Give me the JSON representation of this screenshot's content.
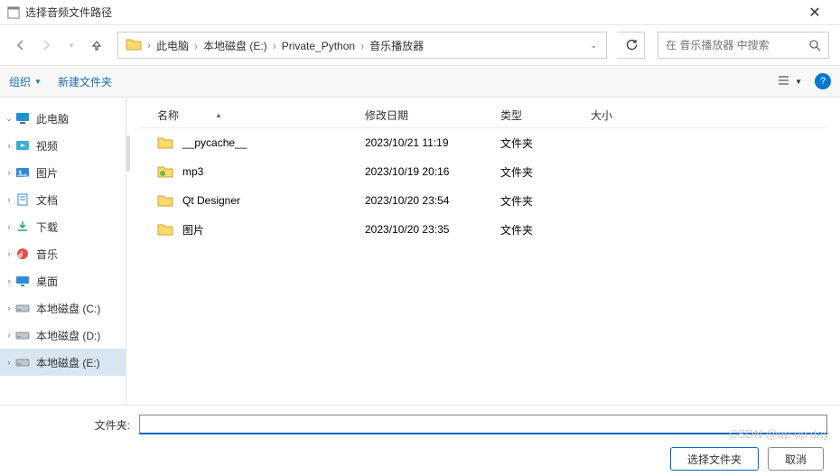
{
  "window": {
    "title": "选择音频文件路径"
  },
  "breadcrumbs": [
    "此电脑",
    "本地磁盘 (E:)",
    "Private_Python",
    "音乐播放器"
  ],
  "search": {
    "placeholder": "在 音乐播放器 中搜索"
  },
  "toolbar": {
    "organize": "组织",
    "newfolder": "新建文件夹"
  },
  "columns": {
    "name": "名称",
    "date": "修改日期",
    "type": "类型",
    "size": "大小"
  },
  "sidebar": [
    {
      "label": "此电脑",
      "icon": "pc",
      "expanded": true,
      "selected": false
    },
    {
      "label": "视频",
      "icon": "video",
      "expanded": false,
      "selected": false
    },
    {
      "label": "图片",
      "icon": "pictures",
      "expanded": false,
      "selected": false
    },
    {
      "label": "文档",
      "icon": "docs",
      "expanded": false,
      "selected": false
    },
    {
      "label": "下载",
      "icon": "downloads",
      "expanded": false,
      "selected": false
    },
    {
      "label": "音乐",
      "icon": "music",
      "expanded": false,
      "selected": false
    },
    {
      "label": "桌面",
      "icon": "desktop",
      "expanded": false,
      "selected": false
    },
    {
      "label": "本地磁盘 (C:)",
      "icon": "drive",
      "expanded": false,
      "selected": false
    },
    {
      "label": "本地磁盘 (D:)",
      "icon": "drive",
      "expanded": false,
      "selected": false
    },
    {
      "label": "本地磁盘 (E:)",
      "icon": "drive",
      "expanded": false,
      "selected": true
    }
  ],
  "files": [
    {
      "name": "__pycache__",
      "date": "2023/10/21 11:19",
      "type": "文件夹",
      "icon": "folder"
    },
    {
      "name": "mp3",
      "date": "2023/10/19 20:16",
      "type": "文件夹",
      "icon": "folder-green"
    },
    {
      "name": "Qt Designer",
      "date": "2023/10/20 23:54",
      "type": "文件夹",
      "icon": "folder"
    },
    {
      "name": "图片",
      "date": "2023/10/20 23:35",
      "type": "文件夹",
      "icon": "folder"
    }
  ],
  "footer": {
    "label": "文件夹:",
    "value": "",
    "select": "选择文件夹",
    "cancel": "取消"
  },
  "watermark": "CSDN @up up day"
}
